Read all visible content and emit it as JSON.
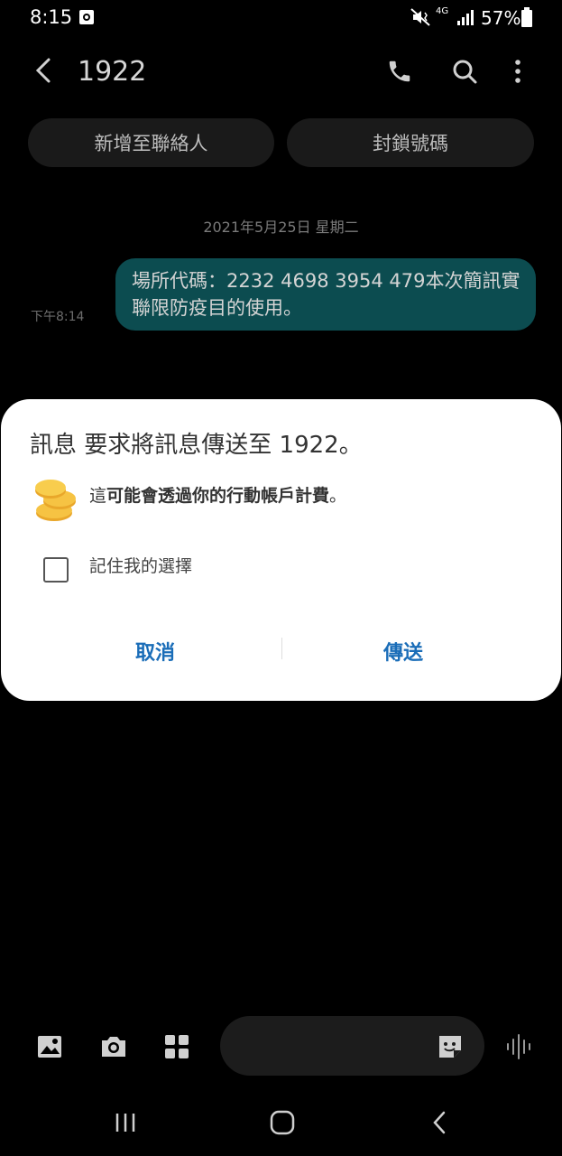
{
  "status_bar": {
    "time": "8:15",
    "network": "4G",
    "battery": "57%",
    "icons": [
      "screenshot-icon",
      "mute-vibrate-icon",
      "signal-icon",
      "battery-icon"
    ]
  },
  "app_bar": {
    "title": "1922",
    "icons": [
      "back-arrow-icon",
      "phone-icon",
      "search-icon",
      "more-options-icon"
    ]
  },
  "actions": {
    "add_contact": "新增至聯絡人",
    "block_number": "封鎖號碼"
  },
  "conversation": {
    "date": "2021年5月25日 星期二",
    "message": {
      "text": "場所代碼：2232 4698 3954 479本次簡訊實聯限防疫目的使用。",
      "time": "下午8:14"
    }
  },
  "dialog": {
    "title": "訊息 要求將訊息傳送至 1922。",
    "warning_prefix": "這",
    "warning_bold": "可能會透過你的行動帳戶計費",
    "warning_suffix": "。",
    "remember_label": "記住我的選擇",
    "remember_checked": false,
    "cancel": "取消",
    "send": "傳送",
    "accent_color": "#1a6db8"
  },
  "composer": {
    "icons": [
      "gallery-icon",
      "camera-icon",
      "apps-grid-icon",
      "sticker-icon",
      "voice-icon"
    ]
  },
  "nav_bar": {
    "icons": [
      "recent-apps-icon",
      "home-icon",
      "back-icon"
    ]
  }
}
